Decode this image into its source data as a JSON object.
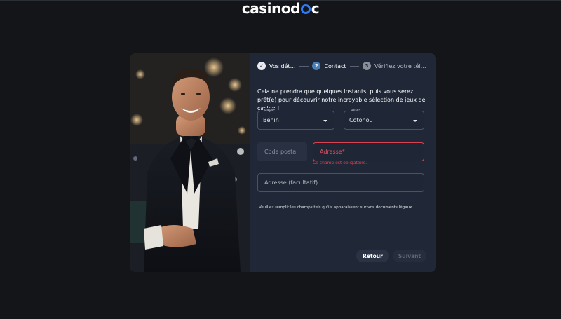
{
  "brand": {
    "logo_left": "casino",
    "logo_right": "d",
    "logo_end": "c"
  },
  "steps": [
    {
      "number": "",
      "label": "Vos détails",
      "state": "done",
      "icon": "check-icon"
    },
    {
      "number": "2",
      "label": "Contact",
      "state": "active"
    },
    {
      "number": "3",
      "label": "Vérifiez votre téléphone",
      "state": "todo"
    }
  ],
  "form": {
    "intro": "Cela ne prendra que quelques instants, puis vous serez prêt(e) pour découvrir notre incroyable sélection de jeux de casino !",
    "country": {
      "label": "Pays*",
      "value": "Bénin"
    },
    "city": {
      "label": "Ville*",
      "value": "Cotonou"
    },
    "postal_code": {
      "placeholder": "Code postal"
    },
    "address": {
      "placeholder": "Adresse*",
      "error": "Ce champ est obligatoire."
    },
    "address_optional": {
      "placeholder": "Adresse (facultatif)"
    },
    "note": "Veuillez remplir les champs tels qu'ils apparaissent sur vos documents légaux."
  },
  "buttons": {
    "back": "Retour",
    "next": "Suivant"
  },
  "colors": {
    "background": "#131519",
    "panel": "#202838",
    "error": "#d8424e",
    "accent": "#4a7fb8"
  }
}
